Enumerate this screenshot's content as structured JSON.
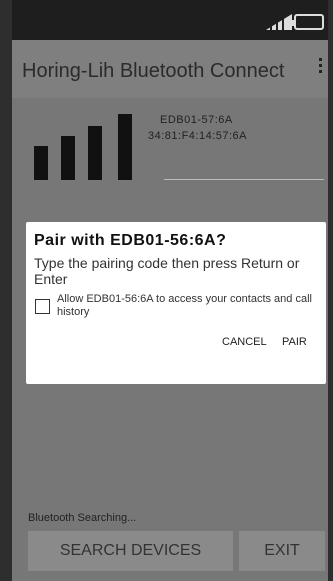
{
  "app": {
    "title": "Horing-Lih Bluetooth Connect"
  },
  "status_bar": {
    "signal_icon": "signal-icon",
    "battery_icon": "battery-icon"
  },
  "device": {
    "name": "EDB01-57:6A",
    "mac": "34:81:F4:14:57:6A",
    "signal_level": 4,
    "signal_max": 4
  },
  "dialog": {
    "title": "Pair with EDB01-56:6A?",
    "message": "Type the pairing code then press Return or Enter",
    "checkbox_label": "Allow EDB01-56:6A to access your contacts and call history",
    "checkbox_checked": false,
    "cancel_label": "CANCEL",
    "pair_label": "PAIR"
  },
  "footer": {
    "status_text": "Bluetooth Searching...",
    "search_label": "SEARCH DEVICES",
    "exit_label": "EXIT"
  },
  "colors": {
    "status_bar": "#1e1e1e",
    "background": "#777777",
    "dialog": "#ffffff",
    "button": "#8a8a8a"
  }
}
